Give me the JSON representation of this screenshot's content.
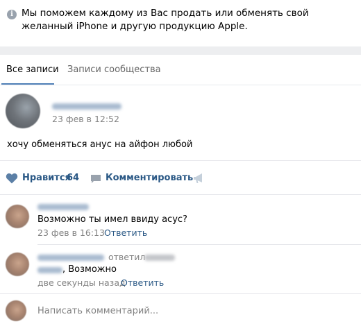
{
  "info": {
    "icon": "info-icon",
    "text": "Мы поможем каждому из Вас продать или обменять свой желанный iPhone и другую продукцию Apple."
  },
  "tabs": [
    {
      "label": "Все записи",
      "active": true
    },
    {
      "label": "Записи сообщества",
      "active": false
    }
  ],
  "post": {
    "date": "23 фев в 12:52",
    "text": "хочу обменяться анус на айфон любой",
    "actions": {
      "like_label": "Нравится",
      "like_count": "64",
      "comment_label": "Комментировать",
      "icons": [
        "heart-icon",
        "comment-icon",
        "megaphone-icon"
      ]
    }
  },
  "comments": [
    {
      "text": "Возможно ты имел ввиду асус?",
      "date": "23 фев в 16:13",
      "reply_label": "Ответить"
    },
    {
      "replied_label": "ответил",
      "text": ", Возможно",
      "date": "две секунды назад",
      "reply_label": "Ответить"
    }
  ],
  "composer": {
    "placeholder": "Написать комментарий..."
  }
}
